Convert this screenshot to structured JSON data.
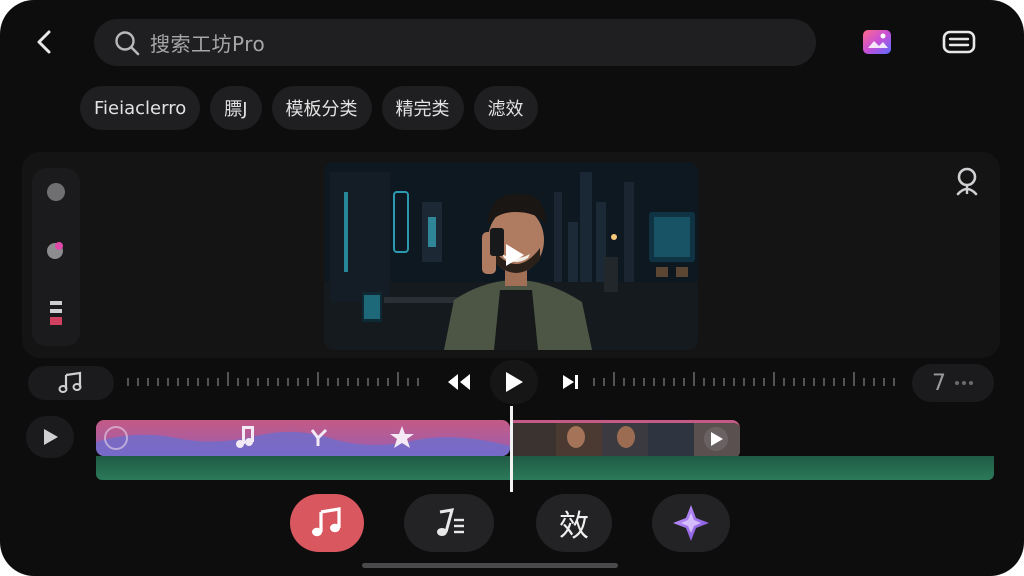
{
  "search": {
    "placeholder": "搜索工坊Pro"
  },
  "chips": [
    "Fieiaclerro",
    "膘J",
    "模板分类",
    "精完类",
    "滤效"
  ],
  "timeline": {
    "duration_label": "7"
  },
  "bottom_tools": {
    "effects_label": "效"
  },
  "colors": {
    "background": "#0d0d0e",
    "surface": "#1f1f21",
    "accent_red": "#d9575f",
    "audio_clip": "#c45a86",
    "green_track": "#2b7a5a"
  },
  "icons": {
    "back": "chevron-left-icon",
    "search": "search-icon",
    "brand": "app-logo-icon",
    "swap": "swap-camera-icon",
    "face": "face-retouch-icon",
    "music": "music-note-icon",
    "prev": "skip-back-icon",
    "play": "play-icon",
    "next": "skip-forward-icon",
    "sound_fx": "sound-effect-icon",
    "sparkle": "sparkle-icon"
  }
}
